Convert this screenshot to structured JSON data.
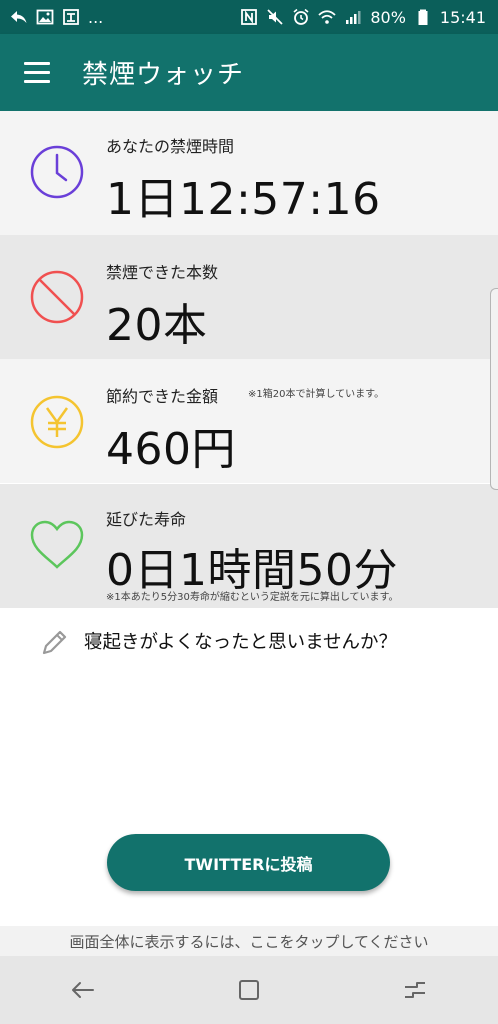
{
  "status_bar": {
    "left_icons": [
      "reply-arrow-icon",
      "image-icon",
      "notification-icon"
    ],
    "overflow": "...",
    "battery_percent": "80%",
    "time": "15:41",
    "right_icons": [
      "nfc-icon",
      "mute-icon",
      "alarm-icon",
      "wifi-icon",
      "signal-icon",
      "battery-icon"
    ]
  },
  "app_bar": {
    "title": "禁煙ウォッチ",
    "menu_icon": "hamburger-menu-icon"
  },
  "cards": {
    "time": {
      "label": "あなたの禁煙時間",
      "value": "1日12:57:16",
      "icon": "clock-icon",
      "color": "#6a3fd8"
    },
    "count": {
      "label": "禁煙できた本数",
      "value": "20本",
      "icon": "no-smoking-icon",
      "color": "#f05050"
    },
    "money": {
      "label": "節約できた金額",
      "value": "460円",
      "note": "※1箱20本で計算しています。",
      "icon": "yen-icon",
      "color": "#f4c430"
    },
    "life": {
      "label": "延びた寿命",
      "value": "0日1時間50分",
      "note": "※1本あたり5分30寿命が縮むという定説を元に算出しています。",
      "icon": "heart-icon",
      "color": "#5cc65c"
    }
  },
  "tip": {
    "text": "寝起きがよくなったと思いませんか？",
    "icon": "pencil-icon"
  },
  "twitter_button": {
    "label": "TWITTERに投稿"
  },
  "fullscreen_hint": "画面全体に表示するには、ここをタップしてください",
  "nav_bar": {
    "icons": [
      "back-icon",
      "home-icon",
      "recents-icon"
    ]
  },
  "colors": {
    "appbar": "#12726c",
    "statusbar": "#0b5f5a",
    "button": "#12726c"
  }
}
